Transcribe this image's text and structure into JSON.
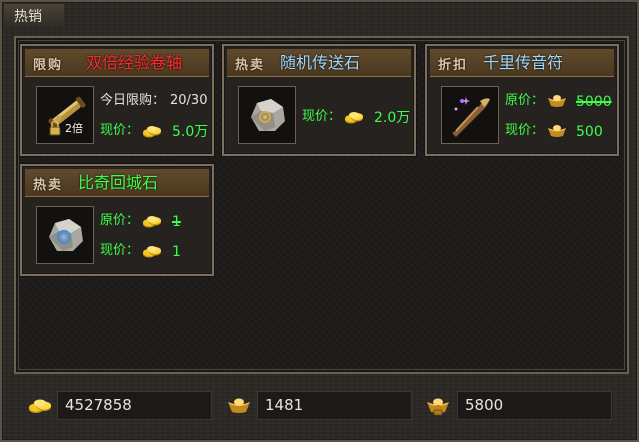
{
  "window": {
    "title": "热销"
  },
  "cards": [
    {
      "badge": "限购",
      "name": "双倍经验卷轴",
      "name_color": "#ff2a2a",
      "icon": "double-exp-scroll-icon",
      "icon_overlay": "2倍",
      "limit_label": "今日限购：",
      "limit_value": "20/30",
      "now_label": "现价：",
      "now_price": "5.0万"
    },
    {
      "badge": "热卖",
      "name": "随机传送石",
      "name_color": "#9fd8ff",
      "icon": "random-teleport-stone-icon",
      "now_label": "现价：",
      "now_price": "2.0万"
    },
    {
      "badge": "折扣",
      "name": "千里传音符",
      "name_color": "#9fd8ff",
      "icon": "thousand-mile-horn-icon",
      "orig_label": "原价：",
      "orig_price": "5000",
      "now_label": "现价：",
      "now_price": "500"
    },
    {
      "badge": "热卖",
      "name": "比奇回城石",
      "name_color": "#3cff4a",
      "icon": "bichi-return-stone-icon",
      "orig_label": "原价：",
      "orig_price": "1",
      "now_label": "现价：",
      "now_price": "1"
    }
  ],
  "currency": {
    "gold": "4527858",
    "ingot": "1481",
    "bound_ingot": "5800"
  },
  "colors": {
    "gold_coin": "#f2c623",
    "ingot": "#e0b040",
    "price_green": "#3cff4a"
  }
}
